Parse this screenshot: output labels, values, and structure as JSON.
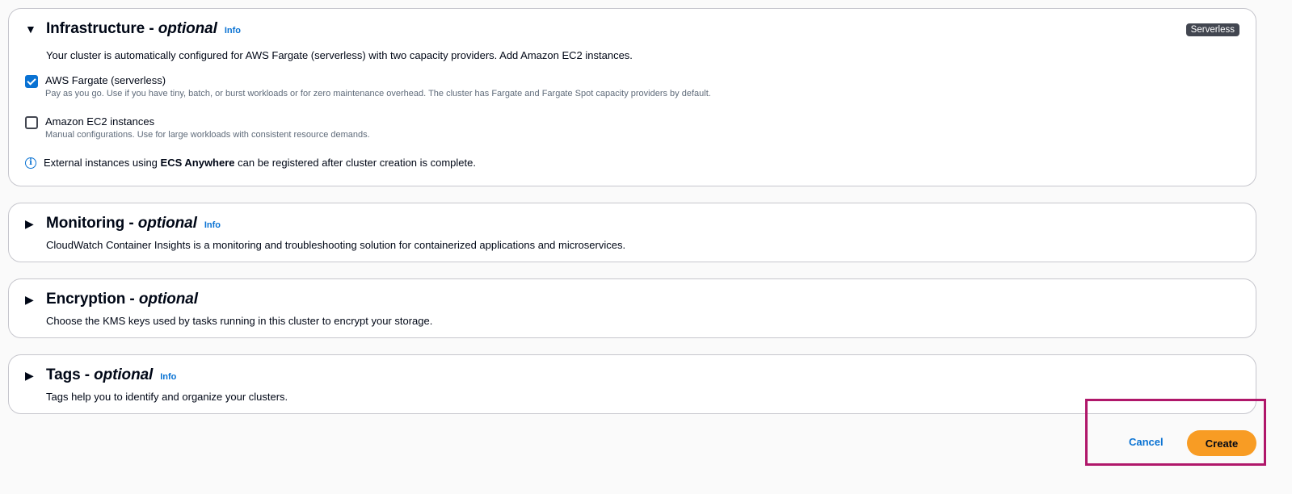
{
  "infrastructure": {
    "title": "Infrastructure",
    "optional": "optional",
    "info": "Info",
    "badge": "Serverless",
    "description": "Your cluster is automatically configured for AWS Fargate (serverless) with two capacity providers. Add Amazon EC2 instances.",
    "options": [
      {
        "label": "AWS Fargate (serverless)",
        "description": "Pay as you go. Use if you have tiny, batch, or burst workloads or for zero maintenance overhead. The cluster has Fargate and Fargate Spot capacity providers by default.",
        "checked": true
      },
      {
        "label": "Amazon EC2 instances",
        "description": "Manual configurations. Use for large workloads with consistent resource demands.",
        "checked": false
      }
    ],
    "note_pre": "External instances using ",
    "note_bold": "ECS Anywhere",
    "note_post": " can be registered after cluster creation is complete."
  },
  "monitoring": {
    "title": "Monitoring",
    "optional": "optional",
    "info": "Info",
    "description": "CloudWatch Container Insights is a monitoring and troubleshooting solution for containerized applications and microservices."
  },
  "encryption": {
    "title": "Encryption",
    "optional": "optional",
    "description": "Choose the KMS keys used by tasks running in this cluster to encrypt your storage."
  },
  "tags": {
    "title": "Tags",
    "optional": "optional",
    "info": "Info",
    "description": "Tags help you to identify and organize your clusters."
  },
  "actions": {
    "cancel": "Cancel",
    "create": "Create"
  },
  "colors": {
    "accent": "#0972d3",
    "primary_button": "#f89c24",
    "highlight_border": "#b0176a"
  }
}
